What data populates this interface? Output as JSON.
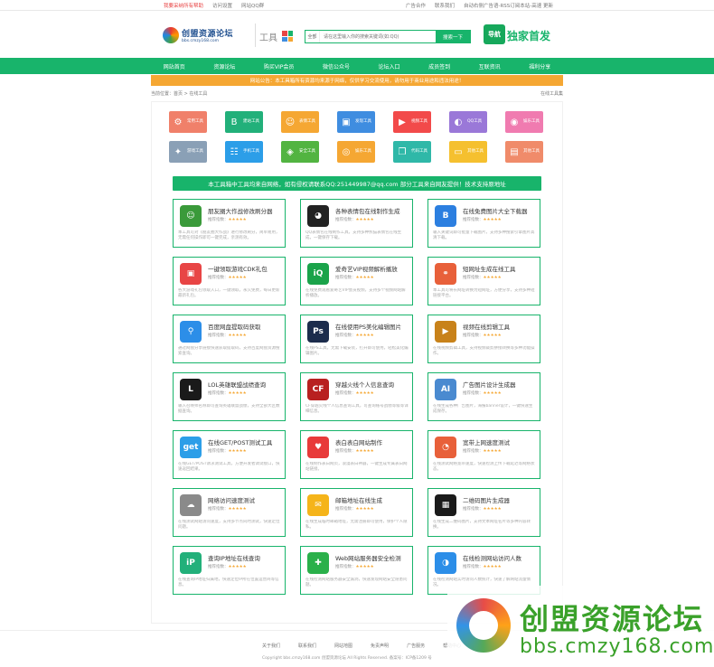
{
  "topbar": {
    "left": [
      "我要采纳所有帮助",
      "访问设置",
      "网站QQ群"
    ],
    "right": [
      "广告合作",
      "联系我们",
      "自动右侧广告语-RSS订阅本站-高速 更新"
    ]
  },
  "header": {
    "logo_main": "创盟资源论坛",
    "logo_sub": "bbs.cmzy168.com",
    "tool_title": "工具",
    "search_select": "全部",
    "search_placeholder": "请在这里输入你的搜索关键词(如:QQ)",
    "search_button": "搜索一下",
    "badge_icon": "导航",
    "badge_text": "独家首发"
  },
  "nav": [
    "网站首页",
    "资源论坛",
    "购买VIP会员",
    "微信公众号",
    "论坛入口",
    "成员签到",
    "互联资讯",
    "福利分享"
  ],
  "notice": "网站公告：本工具箱所有资源均来源于网络，仅供学习交流使用，请勿用于商业用途和违法用途！",
  "breadcrumb": {
    "left": "当前位置：首页 > 在线工具",
    "right": "在线工具集"
  },
  "categories": [
    {
      "label": "常用工具",
      "color": "#f0806a",
      "icon": "gear-icon",
      "glyph": "⚙"
    },
    {
      "label": "建站工具",
      "color": "#22b07a",
      "icon": "b-icon",
      "glyph": "B"
    },
    {
      "label": "表情工具",
      "color": "#f5a733",
      "icon": "smile-icon",
      "glyph": "☺"
    },
    {
      "label": "发现工具",
      "color": "#3f8de0",
      "icon": "gift-icon",
      "glyph": "▣"
    },
    {
      "label": "视频工具",
      "color": "#f24a4a",
      "icon": "video-icon",
      "glyph": "▶"
    },
    {
      "label": "QQ工具",
      "color": "#9a78d8",
      "icon": "qq-icon",
      "glyph": "◐"
    },
    {
      "label": "娱乐工具",
      "color": "#f07bb0",
      "icon": "game-icon",
      "glyph": "◉"
    },
    {
      "label": "游戏工具",
      "color": "#8aa0b6",
      "icon": "gamepad-icon",
      "glyph": "✦"
    },
    {
      "label": "手机工具",
      "color": "#2c9ee8",
      "icon": "phone-icon",
      "glyph": "☷"
    },
    {
      "label": "安全工具",
      "color": "#52b441",
      "icon": "shield-icon",
      "glyph": "◈"
    },
    {
      "label": "娱乐工具",
      "color": "#f5a733",
      "icon": "ball-icon",
      "glyph": "◎"
    },
    {
      "label": "代码工具",
      "color": "#2fb8a8",
      "icon": "code-icon",
      "glyph": "❐"
    },
    {
      "label": "其他工具",
      "color": "#f5c02f",
      "icon": "monitor-icon",
      "glyph": "▭"
    },
    {
      "label": "其他工具",
      "color": "#f08b6a",
      "icon": "doc-icon",
      "glyph": "▤"
    }
  ],
  "green_bar": "本工具箱中工具均来自网络，如有侵权请联系QQ:251449987@qq.com 部分工具来自网友提供！技术支持原地址",
  "cards": [
    {
      "title": "朋友圈大作战修改刷分器",
      "rating": "推荐指数：",
      "stars": "★★★★★",
      "desc": "本工具可对《朋友圈大作战》进行修改刷分，简单易用，无需任何操作即可一键完成，亲测有效。",
      "color": "#3a9a3a",
      "glyph": "☺"
    },
    {
      "title": "各种表情包在线制作生成",
      "rating": "推荐指数：",
      "stars": "★★★★★",
      "desc": "QQ表情包在线制作工具，支持多种熊猫表情包在线生成，一键保存下载。",
      "color": "#222222",
      "glyph": "◕"
    },
    {
      "title": "在线免费图片大全下载器",
      "rating": "推荐指数：",
      "stars": "★★★★★",
      "desc": "输入关键词即可批量下载图片，支持多种搜索引擎图片高清下载。",
      "color": "#2c7fe0",
      "glyph": "B"
    },
    {
      "title": "一键领取游戏CDK礼包",
      "rating": "推荐指数：",
      "stars": "★★★★★",
      "desc": "各大游戏礼包领取入口，一键领取，永久免费，每日更新最新礼包。",
      "color": "#e84545",
      "glyph": "▣"
    },
    {
      "title": "爱奇艺VIP视频解析播放",
      "rating": "推荐指数：",
      "stars": "★★★★★",
      "desc": "在线免费观看爱奇艺VIP会员视频，支持多个视频网站解析播放。",
      "color": "#1aa34a",
      "glyph": "iQ"
    },
    {
      "title": "短网址生成在线工具",
      "rating": "推荐指数：",
      "stars": "★★★★★",
      "desc": "本工具可将长网址转换为短网址，方便分享，支持多种短链接平台。",
      "color": "#e8603a",
      "glyph": "⚭"
    },
    {
      "title": "百度网盘提取码获取",
      "rating": "推荐指数：",
      "stars": "★★★★★",
      "desc": "通过网盘分享链接快速获取提取码，支持百度网盘资源搜索查询。",
      "color": "#2c8ee8",
      "glyph": "⚲"
    },
    {
      "title": "在线使用PS美化编辑图片",
      "rating": "推荐指数：",
      "stars": "★★★★★",
      "desc": "在线PS工具，无需下载安装，打开即可使用，轻松美化编辑图片。",
      "color": "#1c2c4c",
      "glyph": "Ps"
    },
    {
      "title": "视频在线剪辑工具",
      "rating": "推荐指数：",
      "stars": "★★★★★",
      "desc": "在线视频剪辑工具，支持视频裁剪拼接转换等多种功能操作。",
      "color": "#c8821a",
      "glyph": "▶"
    },
    {
      "title": "LOL英雄联盟战绩查询",
      "rating": "推荐指数：",
      "stars": "★★★★★",
      "desc": "输入召唤师名称即可查询英雄联盟战绩，支持全部大区数据查询。",
      "color": "#1a1a1a",
      "glyph": "L"
    },
    {
      "title": "穿越火线个人信息查询",
      "rating": "推荐指数：",
      "stars": "★★★★★",
      "desc": "CF穿越火线个人信息查询工具，可查询账号战绩等级等详细信息。",
      "color": "#b82020",
      "glyph": "CF"
    },
    {
      "title": "广告图片设计生成器",
      "rating": "推荐指数：",
      "stars": "★★★★★",
      "desc": "在线生成各种广告图片，海报banner设计，一键快速生成保存。",
      "color": "#4a8ad0",
      "glyph": "AI"
    },
    {
      "title": "在线GET/POST测试工具",
      "rating": "推荐指数：",
      "stars": "★★★★★",
      "desc": "在线GET/POST请求测试工具，方便开发者调试接口，快速返回结果。",
      "color": "#2c9ee8",
      "glyph": "get"
    },
    {
      "title": "表白表白网站制作",
      "rating": "推荐指数：",
      "stars": "★★★★★",
      "desc": "在线制作表白网页，浪漫表白神器，一键生成专属表白网站链接。",
      "color": "#e83a3a",
      "glyph": "♥"
    },
    {
      "title": "宽带上网速度测试",
      "rating": "推荐指数：",
      "stars": "★★★★★",
      "desc": "在线测试网络宽带速度，快速检测上传下载延迟等网络状态。",
      "color": "#e8603a",
      "glyph": "◔"
    },
    {
      "title": "网络访问速度测试",
      "rating": "推荐指数：",
      "stars": "★★★★★",
      "desc": "在线测试网站访问速度，支持多节点同时测试，快速定位问题。",
      "color": "#8a8a8a",
      "glyph": "☁"
    },
    {
      "title": "邮箱地址在线生成",
      "rating": "推荐指数：",
      "stars": "★★★★★",
      "desc": "在线生成临时邮箱地址，无需注册即可使用，保护个人隐私。",
      "color": "#f5b41a",
      "glyph": "✉"
    },
    {
      "title": "二维码图片生成器",
      "rating": "推荐指数：",
      "stars": "★★★★★",
      "desc": "在线生成二维码图片，支持文本网址名片等多种内容转换。",
      "color": "#1a1a1a",
      "glyph": "▦"
    },
    {
      "title": "查询IP地址在线查询",
      "rating": "推荐指数：",
      "stars": "★★★★★",
      "desc": "在线查询IP地址归属地，快速定位IP所在位置运营商等信息。",
      "color": "#22b07a",
      "glyph": "iP"
    },
    {
      "title": "Web网站服务器安全检测",
      "rating": "推荐指数：",
      "stars": "★★★★★",
      "desc": "在线检测网站服务器安全漏洞，快速发现网站安全隐患问题。",
      "color": "#2ab04a",
      "glyph": "✚"
    },
    {
      "title": "在线检测网站访问人数",
      "rating": "推荐指数：",
      "stars": "★★★★★",
      "desc": "在线检测网站实时访问人数统计，快速了解网站流量情况。",
      "color": "#2c8ee8",
      "glyph": "◑"
    }
  ],
  "footer": {
    "links": [
      "关于我们",
      "联系我们",
      "网站地图",
      "免责声明",
      "广告服务",
      "帮助中心"
    ],
    "copy": "Copyright bbs.cmzy168.com 创盟资源论坛 All Rights Reserved. 备案号：ICP备1209  号"
  },
  "watermark": {
    "title": "创盟资源论坛",
    "url": "bbs.cmzy168.com"
  }
}
